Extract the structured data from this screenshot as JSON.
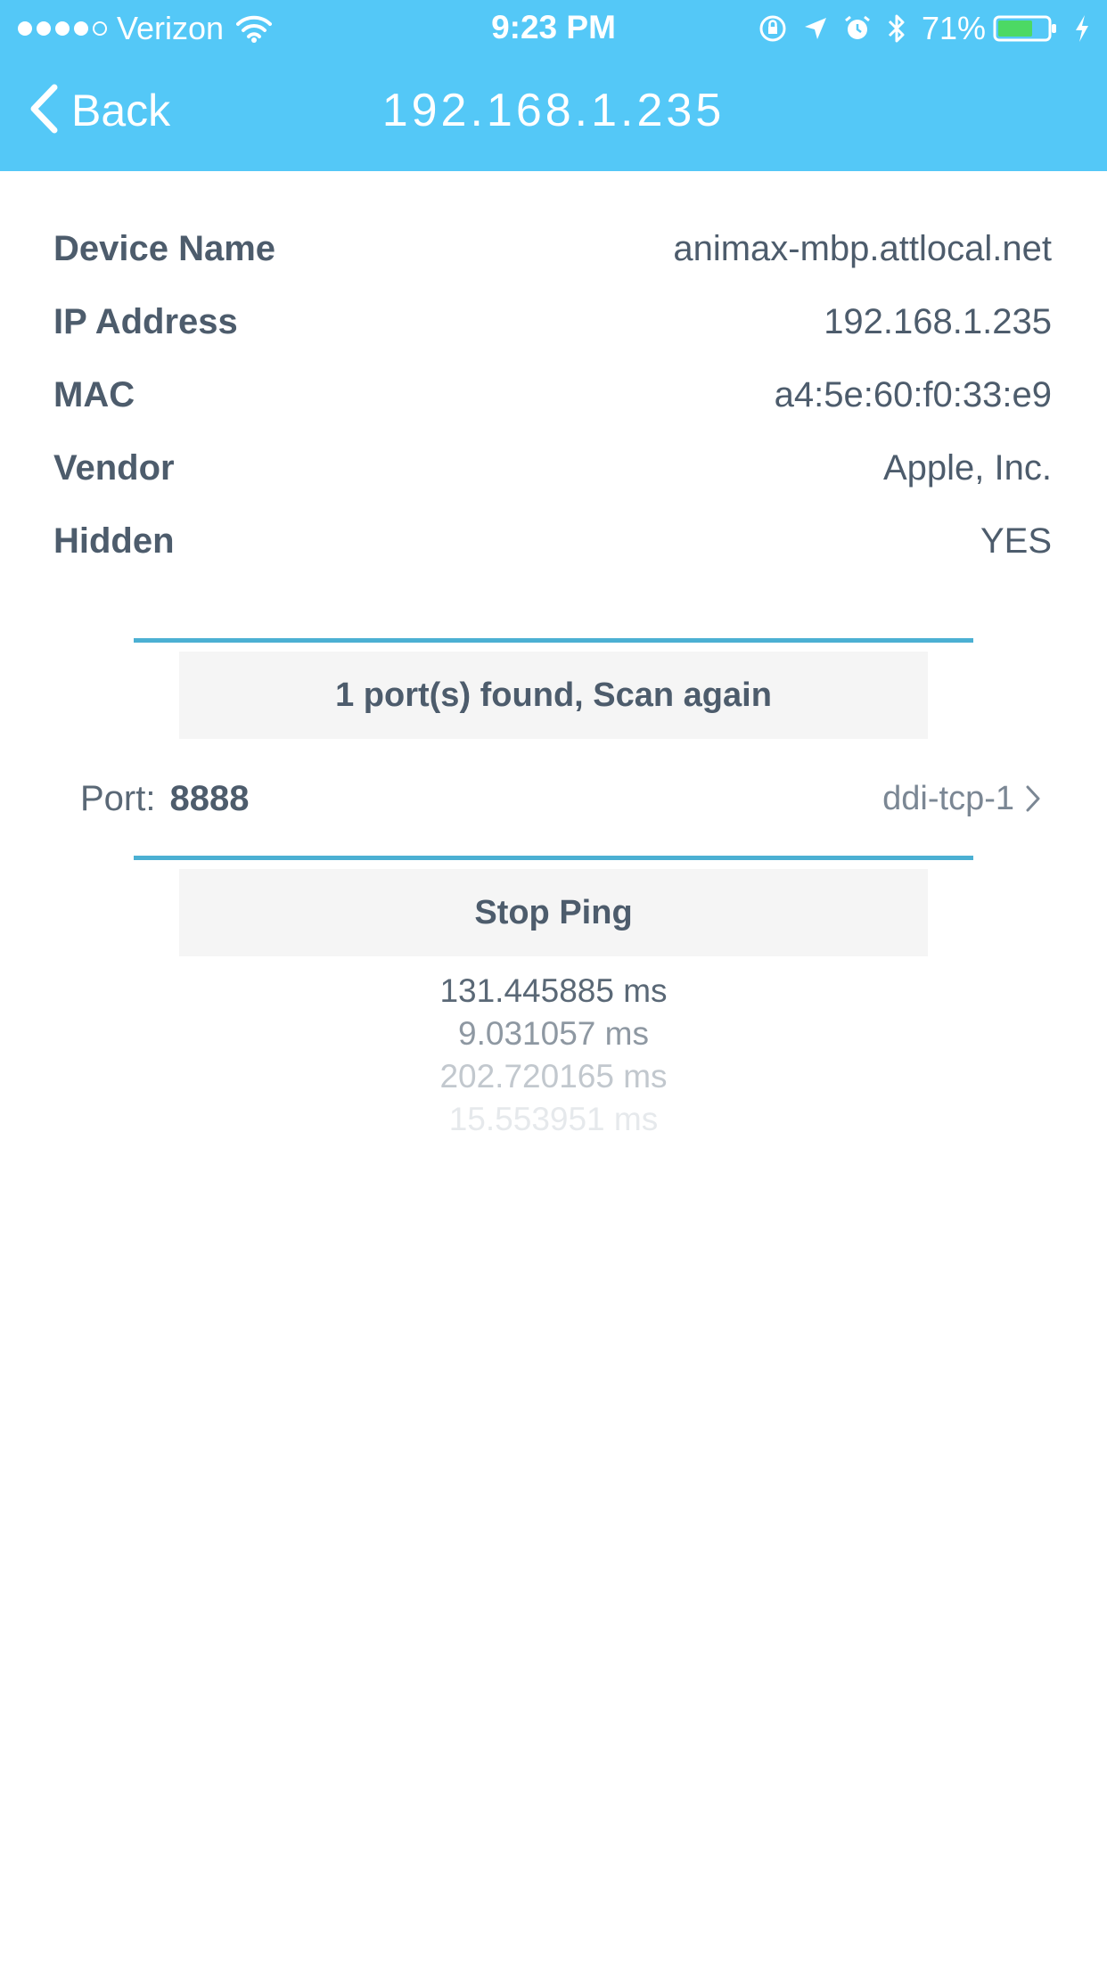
{
  "status_bar": {
    "carrier": "Verizon",
    "time": "9:23 PM",
    "battery_percent": "71%",
    "battery_level": 0.71,
    "signal_bars_filled": 4,
    "signal_bars_total": 5,
    "icons": [
      "wifi-icon",
      "rotation-lock-icon",
      "location-icon",
      "alarm-icon",
      "bluetooth-icon",
      "battery-icon",
      "charging-icon"
    ]
  },
  "nav": {
    "back_label": "Back",
    "title": "192.168.1.235"
  },
  "device_info": [
    {
      "label": "Device Name",
      "value": "animax-mbp.attlocal.net"
    },
    {
      "label": "IP Address",
      "value": "192.168.1.235"
    },
    {
      "label": "MAC",
      "value": "a4:5e:60:f0:33:e9"
    },
    {
      "label": "Vendor",
      "value": "Apple, Inc."
    },
    {
      "label": "Hidden",
      "value": "YES"
    }
  ],
  "port_scan": {
    "button_label": "1 port(s) found, Scan again",
    "ports": [
      {
        "label": "Port:",
        "number": "8888",
        "service": "ddi-tcp-1"
      }
    ]
  },
  "ping": {
    "button_label": "Stop Ping",
    "results": [
      "131.445885 ms",
      "9.031057 ms",
      "202.720165 ms",
      "15.553951 ms"
    ]
  },
  "colors": {
    "header_bg": "#54c8f7",
    "divider": "#4bb0d3",
    "button_bg": "#f5f5f5",
    "text": "#4d5c6c"
  }
}
